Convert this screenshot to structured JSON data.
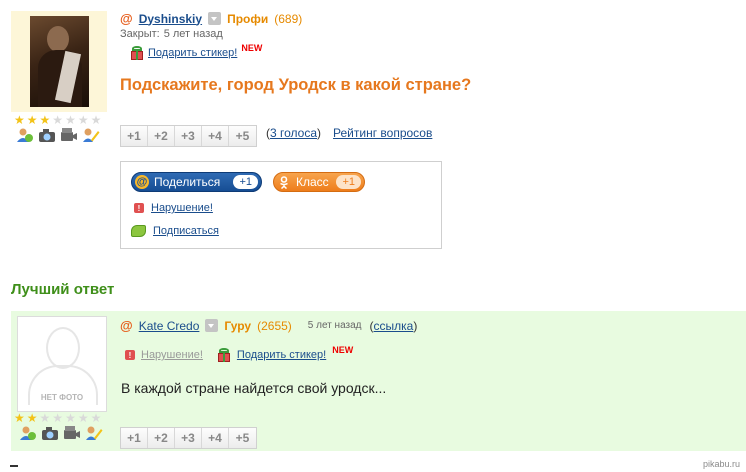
{
  "question": {
    "user": {
      "name": "Dyshinskiy",
      "rank": "Профи",
      "points": "(689)"
    },
    "status": "Закрыт:",
    "closed_ago": "5 лет назад",
    "gift_label": "Подарить стикер!",
    "new_badge": "NEW",
    "title": "Подскажите, город Уродск в какой стране?",
    "votes_count": "3 голоса",
    "votes_open": "(",
    "votes_close": ")",
    "rating_link": "Рейтинг вопросов",
    "rating_stars": 3
  },
  "votes": [
    "+1",
    "+2",
    "+3",
    "+4",
    "+5"
  ],
  "share": {
    "mail_label": "Поделиться",
    "mail_icon": "@",
    "mail_count": "+1",
    "ok_label": "Класс",
    "ok_count": "+1",
    "report_label": "Нарушение!",
    "subscribe_label": "Подписаться"
  },
  "best_answer": {
    "heading": "Лучший ответ",
    "user": {
      "name": "Kate Credo",
      "rank": "Гуру",
      "points": "(2655)"
    },
    "ago": "5 лет назад",
    "link_open": "(",
    "link_label": "ссылка",
    "link_close": ")",
    "report_label": "Нарушение!",
    "gift_label": "Подарить стикер!",
    "new_badge": "NEW",
    "text": "В каждой стране найдется свой уродск...",
    "no_photo": "НЕТ ФОТО",
    "rating_stars": 2
  },
  "icons": [
    "profile-icon",
    "camera-icon",
    "video-icon",
    "pencil-icon",
    "star-icon",
    "dropdown-icon",
    "gift-icon",
    "warning-icon",
    "subscribe-icon",
    "odnoklassniki-icon",
    "mail-at-icon"
  ],
  "colors": {
    "accent_orange": "#e6781e",
    "link_blue": "#1a4d8c",
    "best_green": "#3f8f1a",
    "answer_bg": "#e8fbe0"
  },
  "watermark": "pikabu.ru"
}
